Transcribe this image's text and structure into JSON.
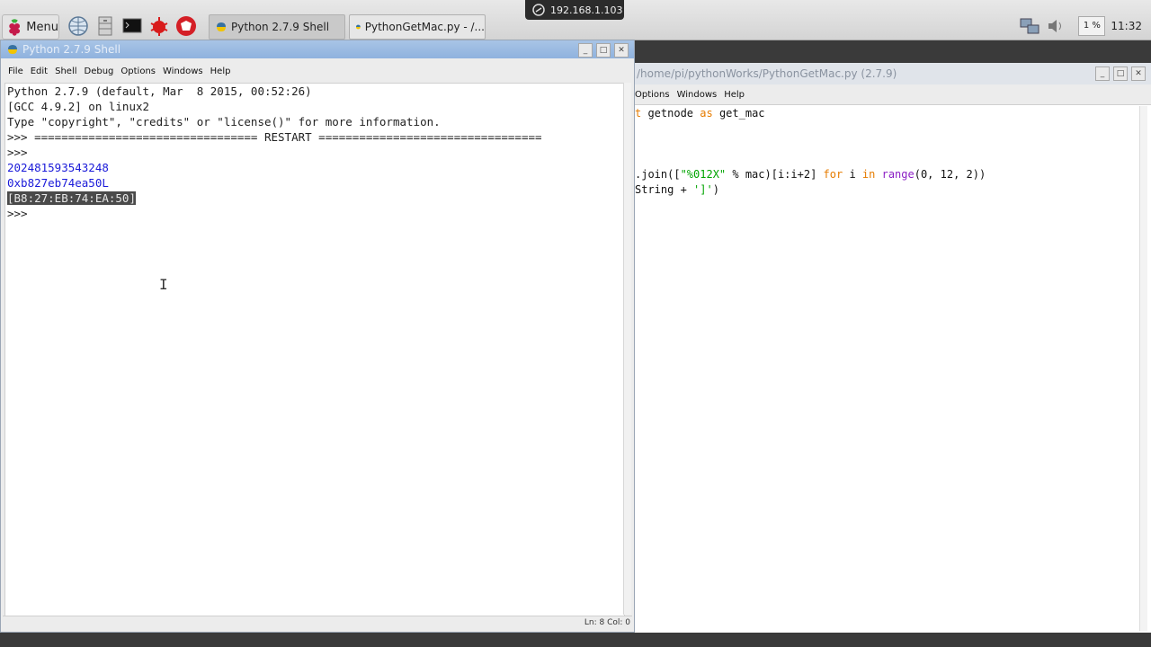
{
  "taskbar": {
    "menu_label": "Menu",
    "tasks": [
      {
        "label": "Python 2.7.9 Shell"
      },
      {
        "label": "PythonGetMac.py - /..."
      }
    ],
    "cpu_label": "1 %",
    "clock": "11:32"
  },
  "remote": {
    "ip": "192.168.1.103"
  },
  "shell": {
    "title": "Python 2.7.9 Shell",
    "menu": [
      "File",
      "Edit",
      "Shell",
      "Debug",
      "Options",
      "Windows",
      "Help"
    ],
    "lines": [
      "Python 2.7.9 (default, Mar  8 2015, 00:52:26)",
      "[GCC 4.9.2] on linux2",
      "Type \"copyright\", \"credits\" or \"license()\" for more information.",
      ">>> ================================= RESTART =================================",
      ">>> ",
      "202481593543248",
      "0xb827eb74ea50L",
      "[B8:27:EB:74:EA:50]",
      ">>> "
    ],
    "status": "Ln: 8 Col: 0"
  },
  "editor": {
    "title": "/home/pi/pythonWorks/PythonGetMac.py (2.7.9)",
    "menu": [
      "Options",
      "Windows",
      "Help"
    ],
    "code": {
      "line1_kw1": "t",
      "line1_a": " getnode ",
      "line1_kw2": "as",
      "line1_b": " get_mac",
      "line2_a": ".join([",
      "line2_str": "\"%012X\"",
      "line2_b": " % mac)[i:i+2] ",
      "line2_kw1": "for",
      "line2_c": " i ",
      "line2_kw2": "in",
      "line2_d": " ",
      "line2_bi": "range",
      "line2_e": "(0, 12, 2))",
      "line3_a": "String + ",
      "line3_str": "']'",
      "line3_b": ")"
    }
  },
  "colors": {
    "keyword": "#e67c00",
    "builtin": "#8b1ec4",
    "string": "#00a400",
    "output": "#1a1ad9"
  }
}
